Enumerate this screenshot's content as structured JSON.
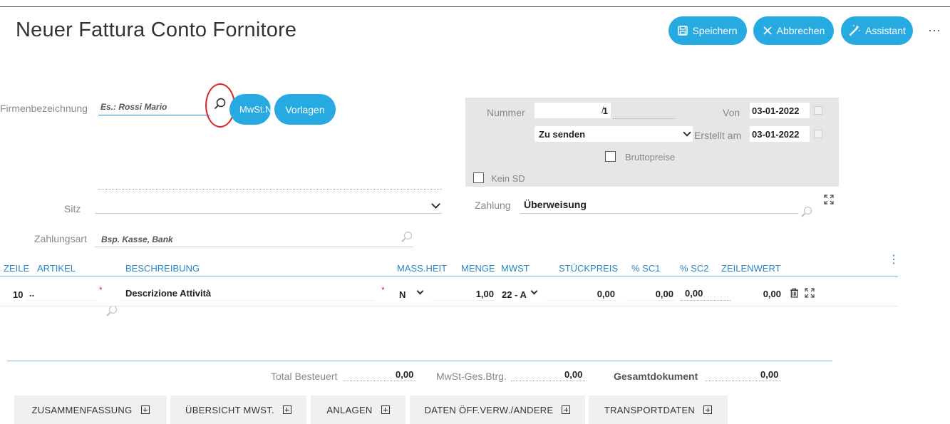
{
  "page": {
    "title": "Neuer Fattura Conto Fornitore"
  },
  "toolbar": {
    "save_label": "Speichern",
    "cancel_label": "Abbrechen",
    "assistant_label": "Assistant",
    "more_label": "···"
  },
  "supplier": {
    "name_label": "Firmenbezeichnung",
    "name_placeholder": "Es.: Rossi Mario",
    "vat_button": "MwSt.N",
    "templates_button": "Vorlagen",
    "seat_label": "Sitz",
    "payment_method_label": "Zahlungsart",
    "payment_method_placeholder": "Bsp. Kasse, Bank"
  },
  "document": {
    "number_label": "Nummer",
    "number_value": "1",
    "number_sep": "/",
    "from_label": "Von",
    "from_value": "03-01-2022",
    "status_value": "Zu senden",
    "created_label": "Erstellt am",
    "created_value": "03-01-2022",
    "gross_prices_label": "Bruttopreise",
    "no_sd_label": "Kein SD",
    "payment_label": "Zahlung",
    "payment_value": "Überweisung"
  },
  "table": {
    "headers": {
      "line": "ZEILE",
      "article": "ARTIKEL",
      "description": "BESCHREIBUNG",
      "unit": "MASS.HEIT",
      "qty": "MENGE",
      "vat": "MWST",
      "unit_price": "STÜCKPREIS",
      "sc1": "% SC1",
      "sc2": "% SC2",
      "line_value": "ZEILENWERT"
    },
    "rows": [
      {
        "line": "10",
        "article": "..",
        "description": "Descrizione Attività",
        "unit": "N",
        "qty": "1,00",
        "vat": "22 - A",
        "unit_price": "0,00",
        "sc1": "0,00",
        "sc2": "0,00",
        "line_value": "0,00"
      }
    ],
    "required_mark": "*"
  },
  "totals": {
    "taxed_label": "Total Besteuert",
    "taxed_value": "0,00",
    "vat_total_label": "MwSt-Ges.Btrg.",
    "vat_total_value": "0,00",
    "doc_total_label": "Gesamtdokument",
    "doc_total_value": "0,00"
  },
  "tabs": [
    {
      "label": "ZUSAMMENFASSUNG"
    },
    {
      "label": "ÜBERSICHT MWST."
    },
    {
      "label": "ANLAGEN"
    },
    {
      "label": "DATEN ÖFF.VERW./ANDERE"
    },
    {
      "label": "TRANSPORTDATEN"
    }
  ],
  "colors": {
    "accent": "#27aae1",
    "header_blue": "#2a87c8",
    "annotation_red": "#d9252a",
    "panel_gray": "#e6e6e6"
  }
}
